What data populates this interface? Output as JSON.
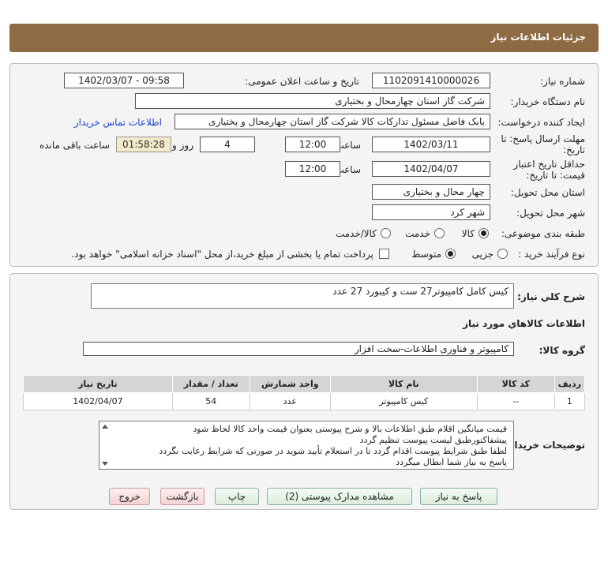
{
  "header": {
    "title": "جزئیات اطلاعات نیاز"
  },
  "form": {
    "need_number_label": "شماره نیاز:",
    "need_number": "1102091410000026",
    "announce_label": "تاریخ و ساعت اعلان عمومی:",
    "announce_value": "1402/03/07 - 09:58",
    "buyer_org_label": "نام دستگاه خریدار:",
    "buyer_org": "شرکت گاز استان چهارمحال و بختیاری",
    "creator_label": "ایجاد کننده درخواست:",
    "creator": "بابک فاضل  مسئول تداركات كالا شرکت گاز استان چهارمحال و بختیاری",
    "contact_link": "اطلاعات تماس خریدار",
    "deadline_label_1": "مهلت ارسال پاسخ: تا",
    "deadline_label_2": "تاریخ:",
    "deadline_date": "1402/03/11",
    "time_label": "ساعت",
    "deadline_time": "12:00",
    "days_value": "4",
    "days_label": "روز و",
    "remaining_time": "01:58:28",
    "remaining_label": "ساعت باقی مانده",
    "validity_label_1": "حداقل تاریخ اعتبار",
    "validity_label_2": "قیمت: تا تاریخ:",
    "validity_date": "1402/04/07",
    "validity_time": "12:00",
    "province_label": "استان محل تحویل:",
    "province": "چهار محال و بختیاری",
    "city_label": "شهر محل تحویل:",
    "city": "شهر کرد",
    "category_label": "طبقه بندی موضوعی:",
    "category_options": [
      "کالا",
      "خدمت",
      "کالا/خدمت"
    ],
    "category_selected": "کالا",
    "process_label": "نوع فرآیند خرید :",
    "process_options": [
      "جزیی",
      "متوسط"
    ],
    "process_selected": "متوسط",
    "payment_note": "پرداخت تمام یا بخشی از مبلغ خرید،از محل \"اسناد خزانه اسلامی\" خواهد بود."
  },
  "details": {
    "general_desc_label": "شرح کلي نياز:",
    "general_desc": "کیس کامل کامپیوتر27 ست و کیبورد 27 عدد",
    "goods_info_title": "اطلاعات کالاهاي مورد نياز",
    "goods_group_label": "گروه کالا:",
    "goods_group": "کامپیوتر و فناوری اطلاعات-سخت افزار",
    "table": {
      "headers": [
        "ردیف",
        "کد کالا",
        "نام کالا",
        "واحد شمارش",
        "تعداد / مقدار",
        "تاریخ نیاز"
      ],
      "rows": [
        [
          "1",
          "--",
          "کیس کامپیوتر",
          "عدد",
          "54",
          "1402/04/07"
        ]
      ]
    },
    "buyer_notes_label": "توضیحات خریدار:",
    "buyer_notes": [
      "قیمت میانگین اقلام طبق   اطلاعات بالا و شرح پیوستی بعنوان قیمت واحد  کالا  لحاظ شود",
      "پیشفاکتورطبق لیست پیوست تنظیم گردد",
      "لطفا طبق شرایط پیوست اقدام گردد   تا در استعلام تأیید شوید در صورتی که شرایط رعایت نگردد",
      "پاسخ به نیاز شما ابطال میگردد"
    ]
  },
  "buttons": {
    "reply": "پاسخ به نیاز",
    "attachments": "مشاهده مدارک پیوستی (2)",
    "print": "چاپ",
    "back": "بازگشت",
    "exit": "خروج"
  }
}
